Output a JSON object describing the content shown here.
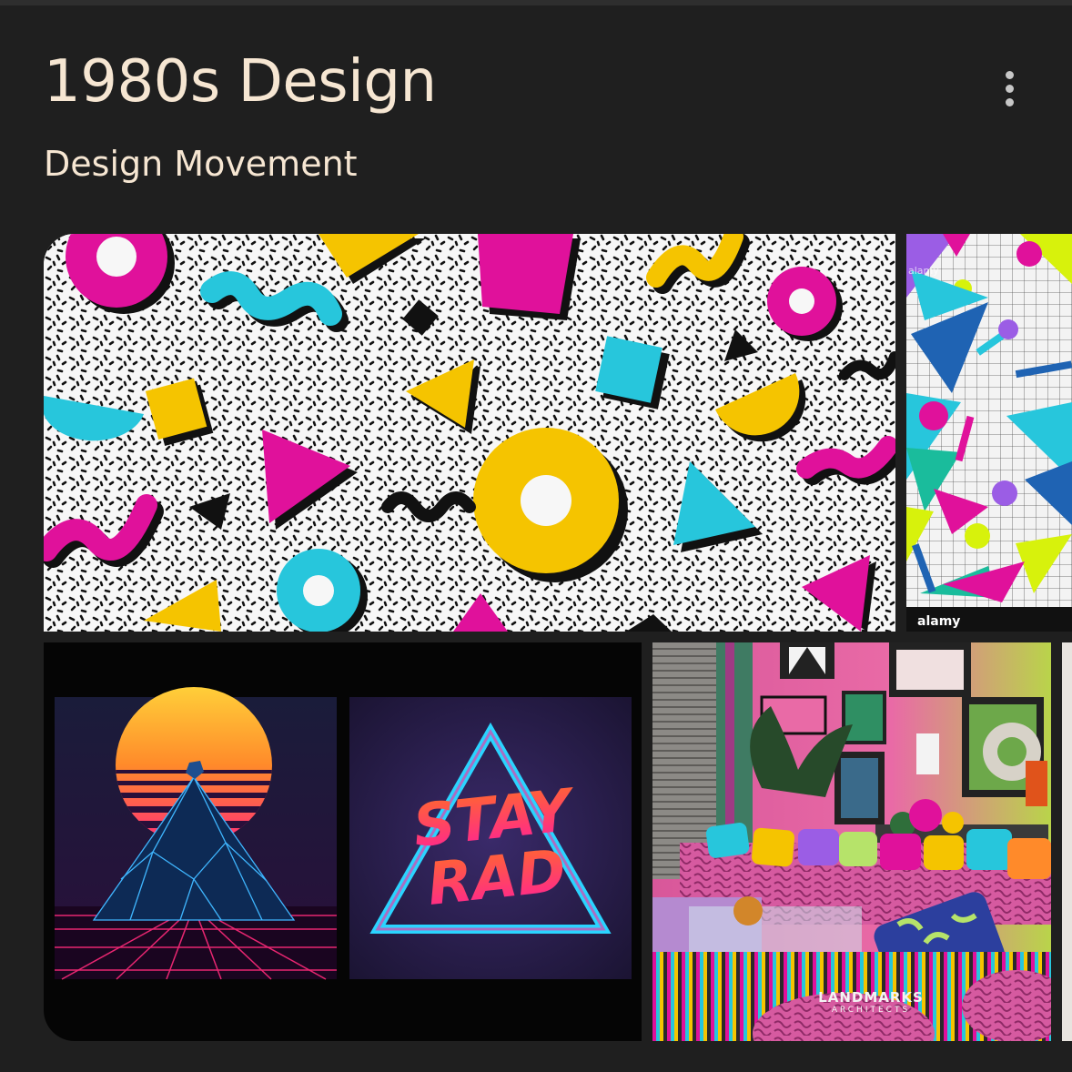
{
  "knowledge_panel": {
    "title": "1980s Design",
    "subtitle": "Design Movement",
    "menu_icon": "more-vert-icon"
  },
  "images": {
    "tile_1": {
      "subject": "Memphis style pattern"
    },
    "tile_2": {
      "watermark_top": "alamy",
      "watermark_bottom": "alamy"
    },
    "tile_3": {
      "poster_text_line1": "STAY",
      "poster_text_line2": "RAD"
    },
    "tile_4": {
      "watermark_line1": "LANDMARKS",
      "watermark_line2": "ARCHITECTS"
    }
  },
  "colors": {
    "background": "#1f1f1f",
    "title_text": "#f6e6d2",
    "magenta": "#e0119b",
    "cyan": "#27c6dc",
    "yellow": "#f5c400"
  }
}
